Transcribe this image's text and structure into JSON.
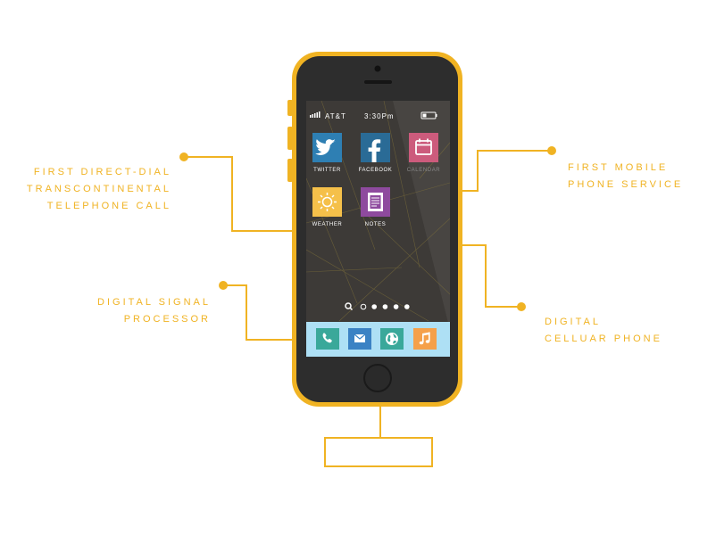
{
  "callouts": [
    {
      "id": "left-top",
      "lines": [
        "FIRST DIRECT-DIAL",
        "TRANSCONTINENTAL",
        "TELEPHONE CALL"
      ]
    },
    {
      "id": "left-bottom",
      "lines": [
        "DIGITAL SIGNAL",
        "PROCESSOR"
      ]
    },
    {
      "id": "right-top",
      "lines": [
        "FIRST MOBILE",
        "PHONE SERVICE"
      ]
    },
    {
      "id": "right-bottom",
      "lines": [
        "DIGITAL",
        "CELLUAR PHONE"
      ]
    }
  ],
  "phone": {
    "status": {
      "carrier": "AT&T",
      "time": "3:30Pm"
    },
    "apps": [
      {
        "label": "TWITTER",
        "color": "#2e7fb3",
        "icon": "twitter-bird-icon"
      },
      {
        "label": "FACEBOOK",
        "color": "#2a6b96",
        "icon": "facebook-f-icon"
      },
      {
        "label": "CALENDAR",
        "color": "#cc5b7c",
        "icon": "calendar-icon"
      },
      {
        "label": "WEATHER",
        "color": "#f5c04a",
        "icon": "sun-icon"
      },
      {
        "label": "NOTES",
        "color": "#8e4a9e",
        "icon": "notes-icon"
      }
    ],
    "dock": [
      {
        "icon": "phone-icon",
        "color": "#3aa89a"
      },
      {
        "icon": "mail-icon",
        "color": "#3b82c4"
      },
      {
        "icon": "globe-icon",
        "color": "#3aa89a"
      },
      {
        "icon": "music-icon",
        "color": "#f5a04a"
      }
    ],
    "page_dots": {
      "count": 5,
      "current": 1
    }
  },
  "colors": {
    "accent": "#f0b323",
    "phone_body": "#2d2d2d",
    "screen": "#3d3a37",
    "dock": "#aee0f5",
    "calendar_label": "#8a8a8a"
  }
}
